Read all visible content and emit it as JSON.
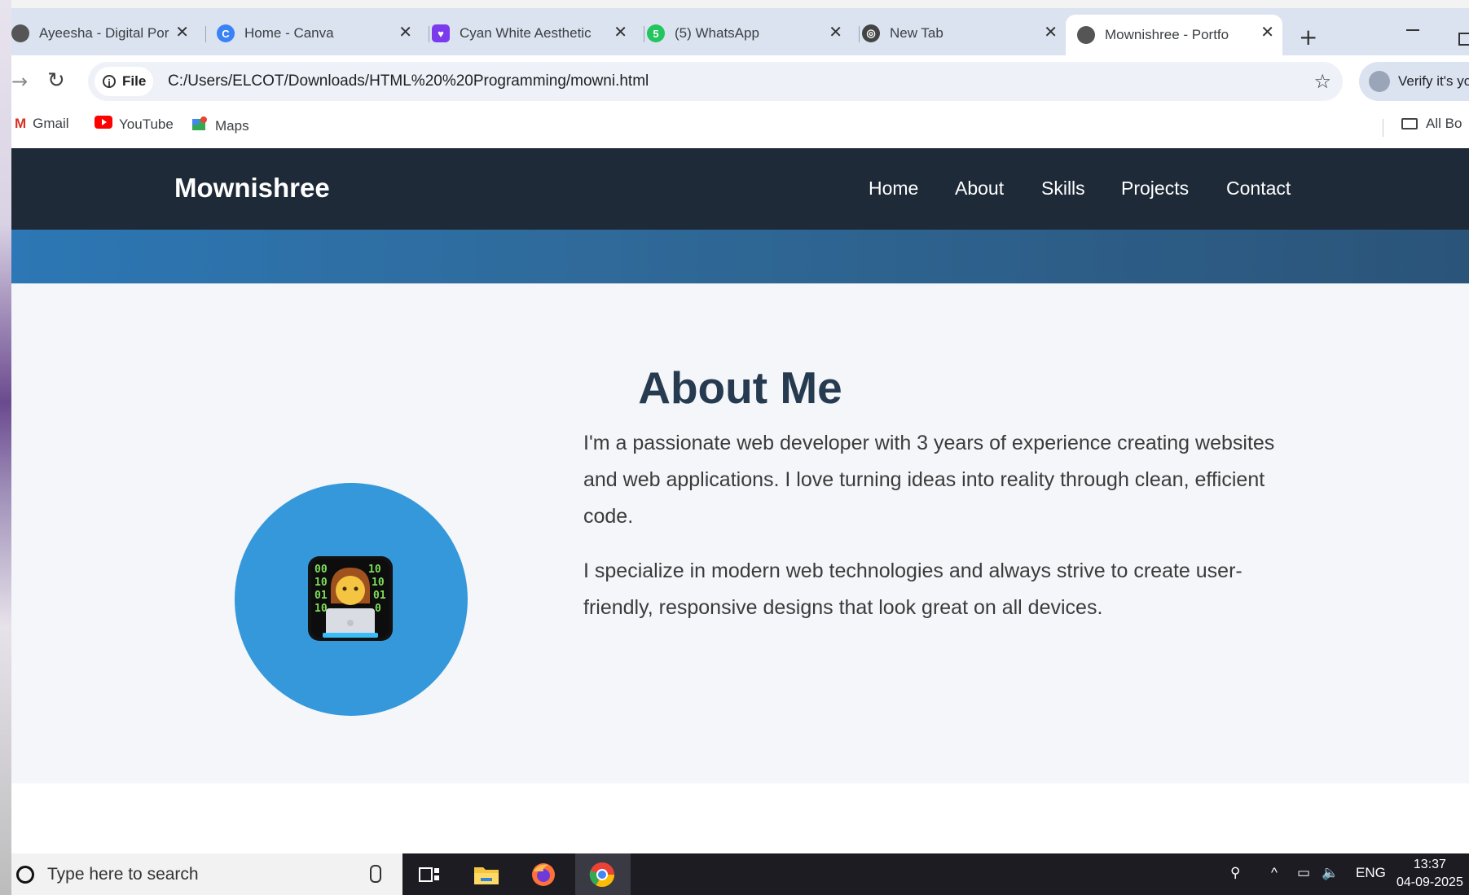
{
  "browser": {
    "tabs": [
      {
        "label": "Ayeesha - Digital Por",
        "icon": "globe-icon",
        "active": false
      },
      {
        "label": "Home - Canva",
        "icon": "canva-icon",
        "active": false
      },
      {
        "label": "Cyan White Aesthetic",
        "icon": "canva-design-icon",
        "active": false
      },
      {
        "label": "(5) WhatsApp",
        "icon": "whatsapp-icon",
        "active": false
      },
      {
        "label": "New Tab",
        "icon": "chrome-icon",
        "active": false
      },
      {
        "label": "Mownishree - Portfo",
        "icon": "globe-icon",
        "active": true
      }
    ],
    "new_tab": "+",
    "address": {
      "scheme_label": "File",
      "url": "C:/Users/ELCOT/Downloads/HTML%20%20Programming/mowni.html"
    },
    "profile_chip": "Verify it's you",
    "bookmarks": [
      {
        "label": "Gmail",
        "icon": "gmail-icon"
      },
      {
        "label": "YouTube",
        "icon": "youtube-icon"
      },
      {
        "label": "Maps",
        "icon": "maps-icon"
      }
    ],
    "all_bookmarks": "All Bo"
  },
  "site": {
    "brand": "Mownishree",
    "nav": [
      "Home",
      "About",
      "Skills",
      "Projects",
      "Contact"
    ],
    "about": {
      "title": "About Me",
      "paragraphs": [
        "I'm a passionate web developer with 3 years of experience creating websites and web applications. I love turning ideas into reality through clean, efficient code.",
        "I specialize in modern web technologies and always strive to create user-friendly, responsive designs that look great on all devices."
      ]
    }
  },
  "taskbar": {
    "search_placeholder": "Type here to search",
    "language": "ENG",
    "time": "13:37",
    "date": "04-09-2025"
  },
  "colors": {
    "nav_bg": "#1e2a38",
    "accent_blue": "#3498db",
    "heading": "#263b50"
  }
}
